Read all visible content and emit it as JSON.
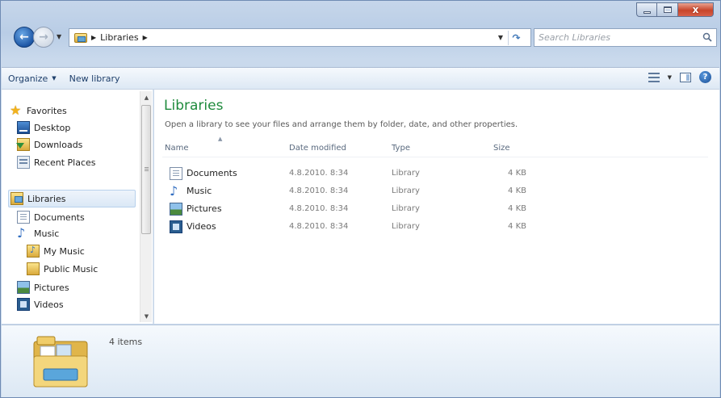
{
  "window": {
    "caption_min": "–",
    "caption_close": "x"
  },
  "address_bar": {
    "crumb": "Libraries",
    "search_placeholder": "Search Libraries"
  },
  "toolbar": {
    "organize_label": "Organize",
    "new_library_label": "New library"
  },
  "nav_pane": {
    "items": [
      {
        "label": "Favorites",
        "icon": "star-icon"
      },
      {
        "label": "Desktop",
        "icon": "desktop-icon"
      },
      {
        "label": "Downloads",
        "icon": "downloads-icon"
      },
      {
        "label": "Recent Places",
        "icon": "recent-places-icon"
      },
      {
        "label": "Libraries",
        "icon": "libraries-icon",
        "selected": true
      },
      {
        "label": "Documents",
        "icon": "documents-icon"
      },
      {
        "label": "Music",
        "icon": "music-icon"
      },
      {
        "label": "My Music",
        "icon": "my-music-icon"
      },
      {
        "label": "Public Music",
        "icon": "public-music-icon"
      },
      {
        "label": "Pictures",
        "icon": "pictures-icon"
      },
      {
        "label": "Videos",
        "icon": "videos-icon"
      }
    ]
  },
  "content": {
    "title": "Libraries",
    "subtitle": "Open a library to see your files and arrange them by folder, date, and other properties.",
    "columns": [
      "Name",
      "Date modified",
      "Type",
      "Size"
    ],
    "rows": [
      {
        "name": "Documents",
        "date": "4.8.2010. 8:34",
        "type": "Library",
        "size": "4 KB",
        "icon": "documents-icon"
      },
      {
        "name": "Music",
        "date": "4.8.2010. 8:34",
        "type": "Library",
        "size": "4 KB",
        "icon": "music-icon"
      },
      {
        "name": "Pictures",
        "date": "4.8.2010. 8:34",
        "type": "Library",
        "size": "4 KB",
        "icon": "pictures-icon"
      },
      {
        "name": "Videos",
        "date": "4.8.2010. 8:34",
        "type": "Library",
        "size": "4 KB",
        "icon": "videos-icon"
      }
    ]
  },
  "details_pane": {
    "item_count": "4 items"
  },
  "colors": {
    "title_green": "#1e8a3c",
    "toolbar_text": "#1e3f6b",
    "selection_border": "#b8d1ec"
  }
}
